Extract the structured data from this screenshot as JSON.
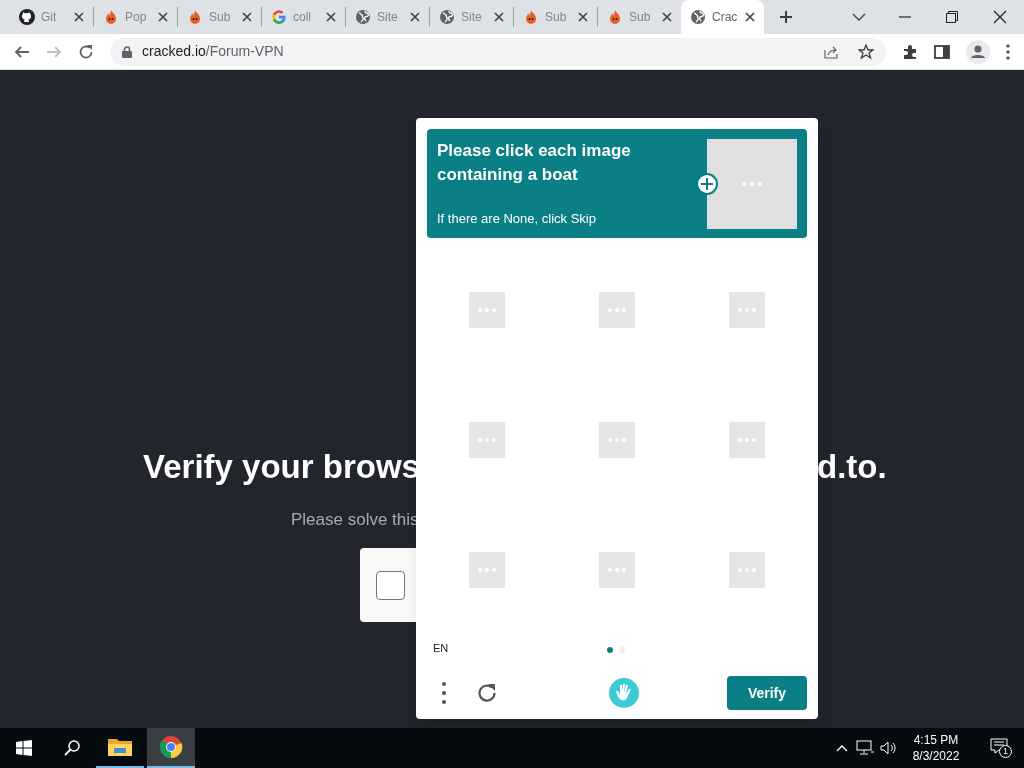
{
  "tabs": [
    {
      "label": "Git",
      "kind": "github",
      "selected": false
    },
    {
      "label": "Pop",
      "kind": "fire",
      "selected": false
    },
    {
      "label": "Sub",
      "kind": "fire",
      "selected": false
    },
    {
      "label": "coll",
      "kind": "google",
      "selected": false
    },
    {
      "label": "Site",
      "kind": "globe",
      "selected": false
    },
    {
      "label": "Site",
      "kind": "globe",
      "selected": false
    },
    {
      "label": "Sub",
      "kind": "fire",
      "selected": false
    },
    {
      "label": "Sub",
      "kind": "fire",
      "selected": false
    },
    {
      "label": "Crac",
      "kind": "globe",
      "selected": true
    }
  ],
  "address_bar": {
    "host": "cracked.io",
    "path": "/Forum-VPN"
  },
  "page": {
    "heading_left": "Verify your brows",
    "heading_right": "d.to.",
    "subtitle": "Please solve this",
    "checkbox": {
      "checked": false
    }
  },
  "captcha": {
    "prompt": "Please click each image containing a boat",
    "hint": "If there are None, click Skip",
    "tiles": [
      {
        "selected": false
      },
      {
        "selected": false
      },
      {
        "selected": false
      },
      {
        "selected": false
      },
      {
        "selected": false
      },
      {
        "selected": false
      },
      {
        "selected": false
      },
      {
        "selected": false
      },
      {
        "selected": false
      }
    ],
    "language": "EN",
    "pages": [
      {
        "selected": true
      },
      {
        "selected": false
      }
    ],
    "verify_button": "Verify"
  },
  "taskbar": {
    "apps": [
      {
        "kind": "explorer",
        "selected": false
      },
      {
        "kind": "chrome",
        "selected": true
      }
    ],
    "time": "4:15 PM",
    "date": "8/3/2022",
    "notifications": "1"
  }
}
